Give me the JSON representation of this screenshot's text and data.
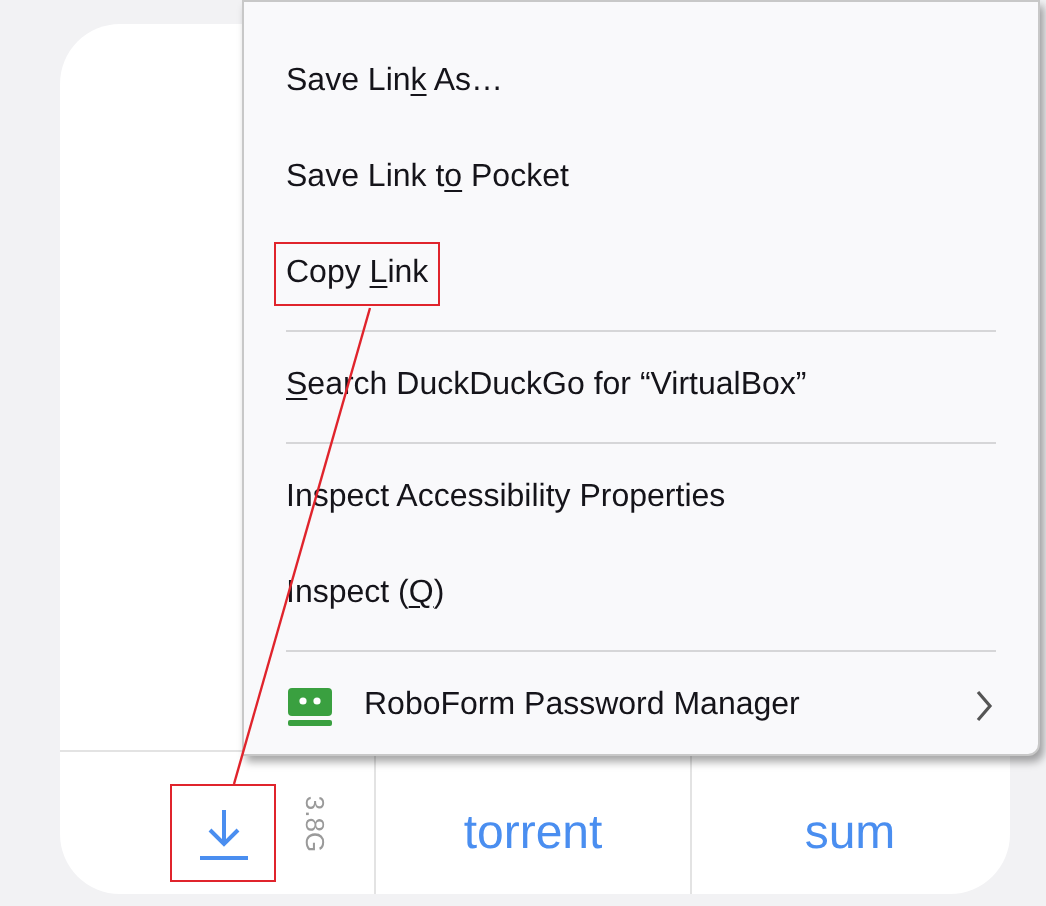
{
  "context_menu": {
    "items": [
      {
        "kind": "item",
        "label_start": "Save Lin",
        "access_key": "k",
        "label_end": " As…",
        "highlighted": false
      },
      {
        "kind": "item",
        "label_start": "Save Link t",
        "access_key": "o",
        "label_end": " Pocket",
        "highlighted": false
      },
      {
        "kind": "item",
        "label_start": "Copy ",
        "access_key": "L",
        "label_end": "ink",
        "highlighted": true
      },
      {
        "kind": "separator"
      },
      {
        "kind": "item",
        "access_key": "S",
        "label_end": "earch DuckDuckGo for “VirtualBox”",
        "highlighted": false
      },
      {
        "kind": "separator"
      },
      {
        "kind": "item",
        "label_start": "Inspect Accessibility Properties",
        "highlighted": false
      },
      {
        "kind": "item",
        "label_start": "Inspect (",
        "access_key": "Q",
        "label_end": ")",
        "highlighted": false
      },
      {
        "kind": "separator"
      },
      {
        "kind": "submenu",
        "label": "RoboForm Password Manager"
      }
    ]
  },
  "download_row": {
    "download_highlighted": true,
    "size": "3.8G",
    "links": [
      "torrent",
      "sum"
    ]
  }
}
